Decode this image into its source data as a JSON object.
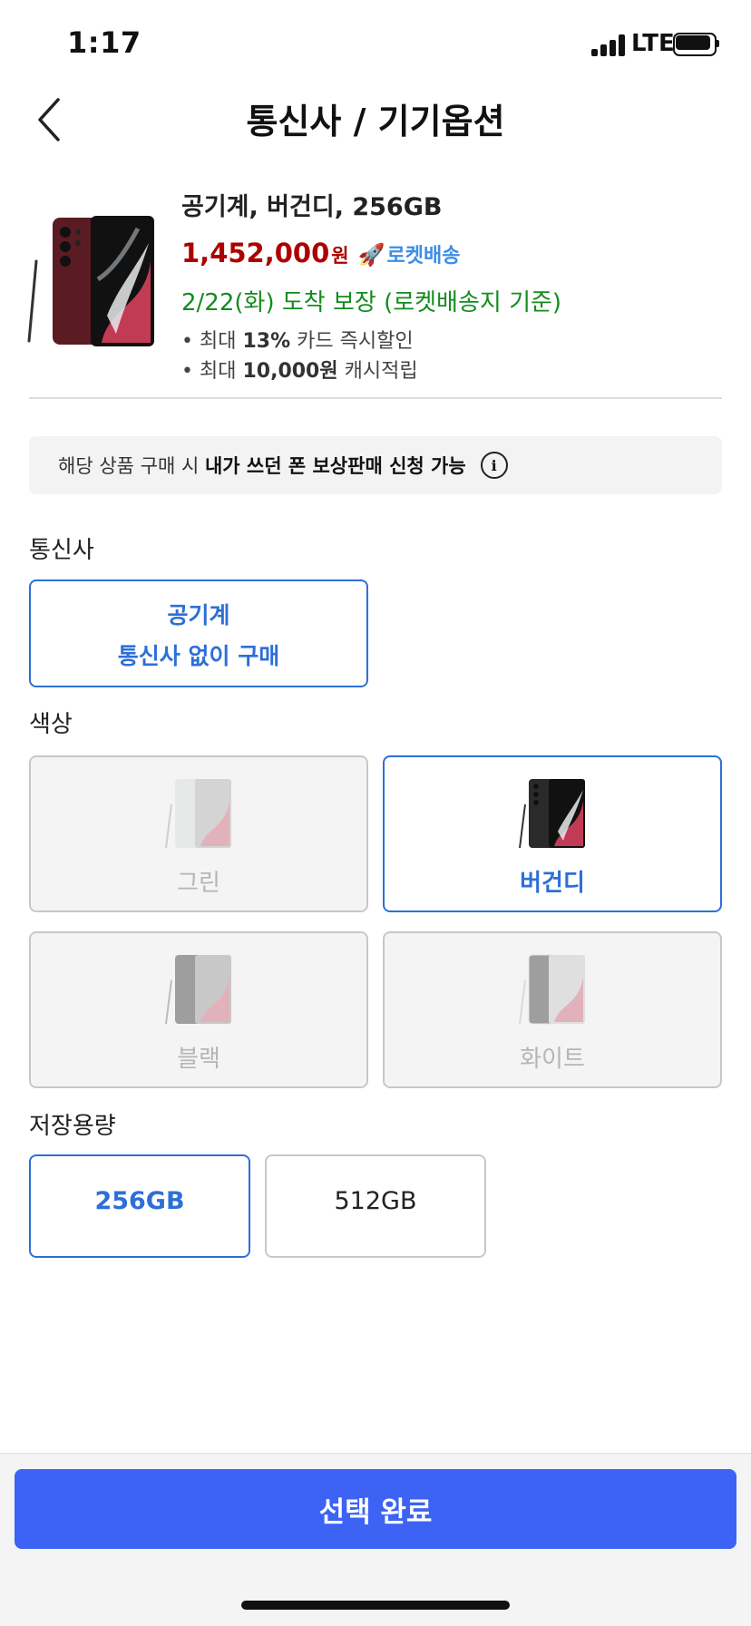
{
  "status_bar": {
    "time": "1:17",
    "network": "LTE"
  },
  "header": {
    "title": "통신사 / 기기옵션"
  },
  "product": {
    "name": "공기계, 버건디, 256GB",
    "price": "1,452,000",
    "currency": "원",
    "shipping_badge": "로켓배송",
    "delivery": "2/22(화) 도착 보장 (로켓배송지 기준)",
    "benefits": [
      {
        "prefix": "최대 ",
        "strong": "13%",
        "suffix": " 카드 즉시할인"
      },
      {
        "prefix": "최대 ",
        "strong": "10,000원",
        "suffix": " 캐시적립"
      }
    ]
  },
  "notice": {
    "text_plain": "해당 상품 구매 시 ",
    "text_strong": "내가 쓰던 폰 보상판매 신청 가능"
  },
  "carrier": {
    "label": "통신사",
    "option_line1": "공기계",
    "option_line2": "통신사 없이 구매"
  },
  "color": {
    "label": "색상",
    "options": [
      {
        "name": "그린",
        "selected": false,
        "body": "#cfd6d2"
      },
      {
        "name": "버건디",
        "selected": true,
        "body": "#5a1c22"
      },
      {
        "name": "블랙",
        "selected": false,
        "body": "#2a2a2a"
      },
      {
        "name": "화이트",
        "selected": false,
        "body": "#eeeeee"
      }
    ]
  },
  "storage": {
    "label": "저장용량",
    "options": [
      {
        "name": "256GB",
        "selected": true
      },
      {
        "name": "512GB",
        "selected": false
      }
    ]
  },
  "confirm_button": "선택 완료",
  "colors": {
    "accent": "#2d6fd8",
    "price": "#ae0000",
    "delivery": "#148c1f",
    "cta": "#3d63f5"
  }
}
